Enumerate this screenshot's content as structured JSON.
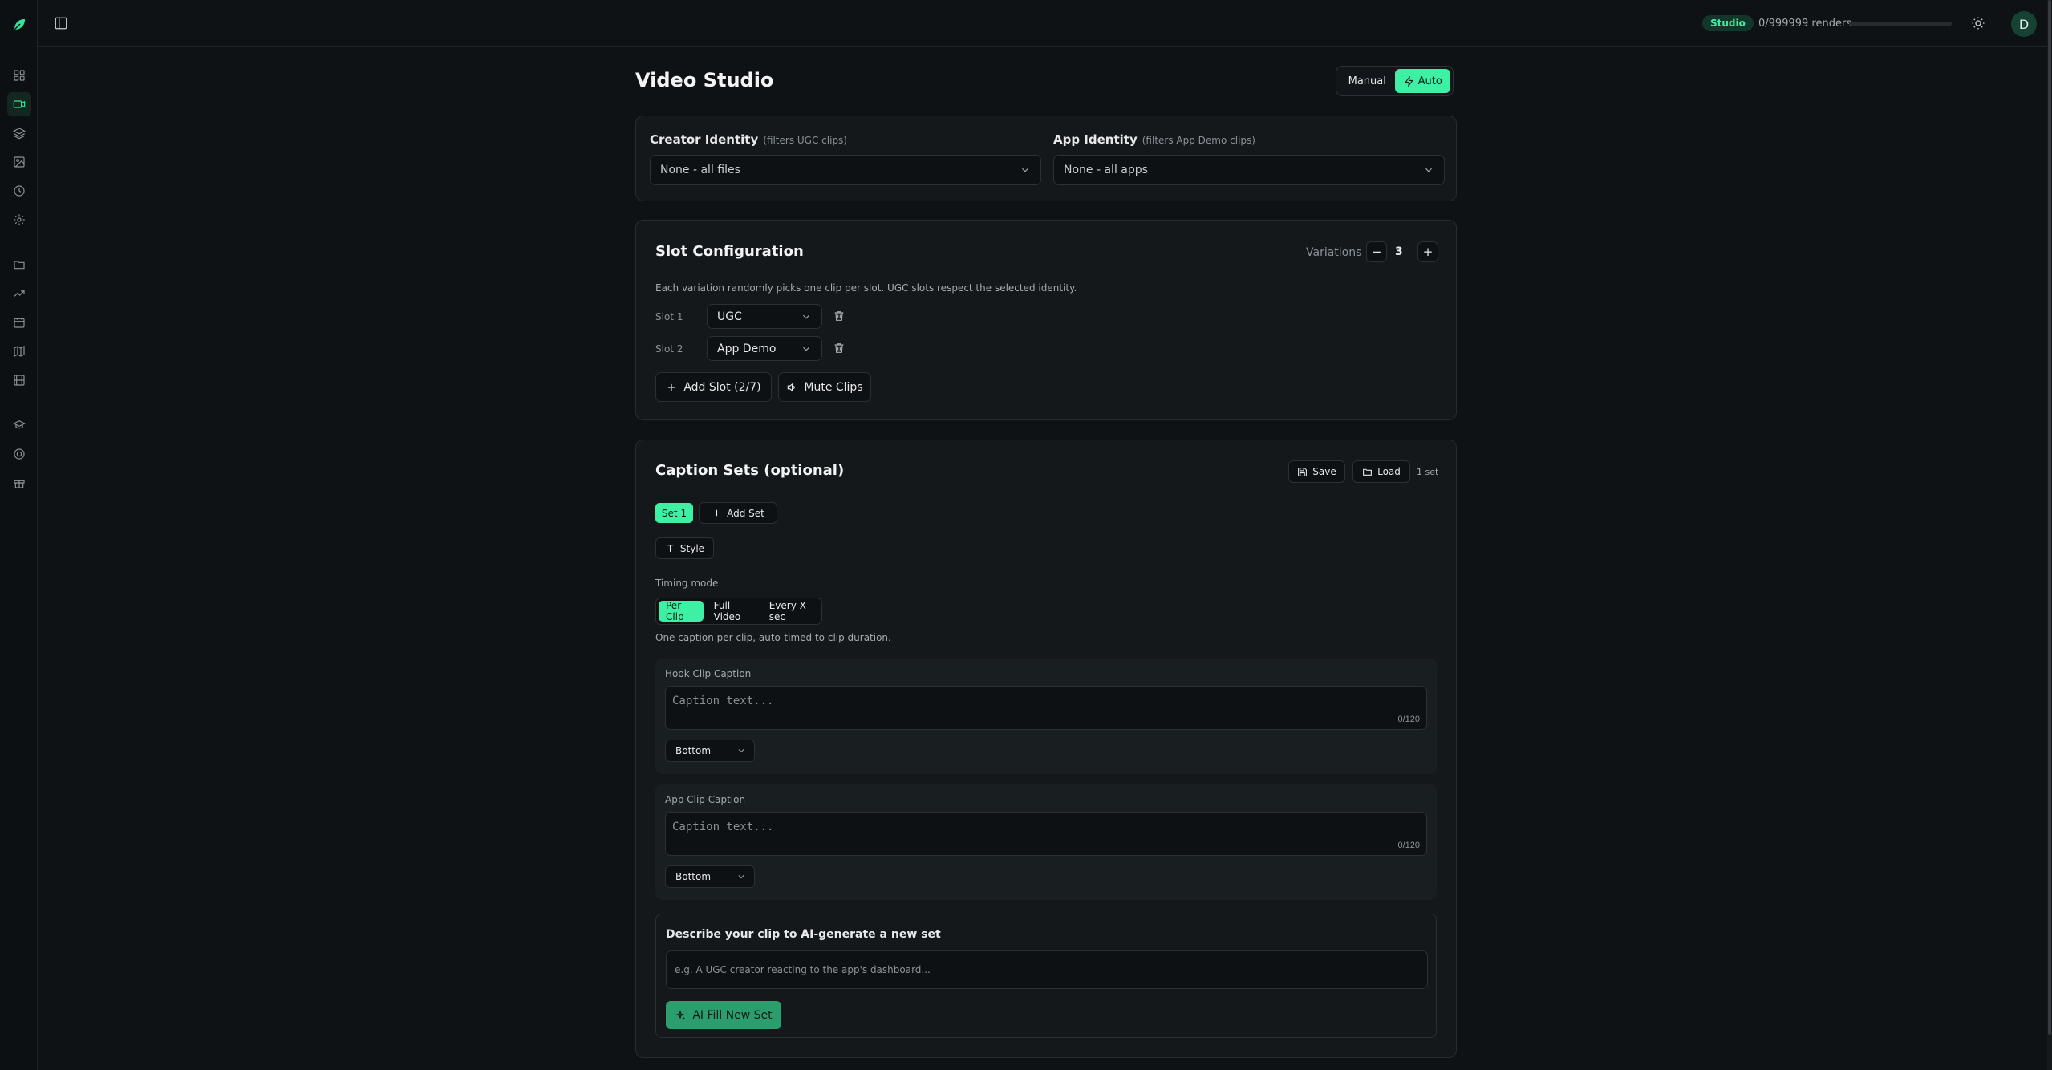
{
  "topbar": {
    "badge": "Studio",
    "renders": "0/999999 renders",
    "render_progress_percent": 0,
    "avatar_initial": "D"
  },
  "sidebar": {
    "icons": [
      "dashboard-icon",
      "video-icon",
      "layers-icon",
      "image-icon",
      "clock-icon",
      "settings-icon",
      "folder-icon",
      "trending-icon",
      "calendar-icon",
      "map-icon",
      "film-icon",
      "graduation-icon",
      "help-circle-icon",
      "gift-icon"
    ],
    "active": "video-icon"
  },
  "page": {
    "title": "Video Studio",
    "mode_manual": "Manual",
    "mode_auto": "Auto",
    "active_mode": "Auto"
  },
  "identity": {
    "creator_label": "Creator Identity",
    "creator_hint": "(filters UGC clips)",
    "creator_value": "None - all files",
    "app_label": "App Identity",
    "app_hint": "(filters App Demo clips)",
    "app_value": "None - all apps"
  },
  "slots": {
    "title": "Slot Configuration",
    "variations_label": "Variations",
    "variations_value": "3",
    "minus": "−",
    "plus": "+",
    "description": "Each variation randomly picks one clip per slot. UGC slots respect the selected identity.",
    "items": [
      {
        "label": "Slot 1",
        "value": "UGC"
      },
      {
        "label": "Slot 2",
        "value": "App Demo"
      }
    ],
    "add_slot": "Add Slot (2/7)",
    "mute_clips": "Mute Clips"
  },
  "captions": {
    "title": "Caption Sets (optional)",
    "save": "Save",
    "load": "Load",
    "set_count": "1 set",
    "active_set": "Set 1",
    "add_set": "Add Set",
    "style": "Style",
    "timing_label": "Timing mode",
    "timing_modes": [
      "Per Clip",
      "Full Video",
      "Every X sec"
    ],
    "active_timing": "Per Clip",
    "timing_description": "One caption per clip, auto-timed to clip duration.",
    "clips": [
      {
        "label": "Hook Clip Caption",
        "placeholder": "Caption text...",
        "counter": "0/120",
        "position": "Bottom"
      },
      {
        "label": "App Clip Caption",
        "placeholder": "Caption text...",
        "counter": "0/120",
        "position": "Bottom"
      }
    ],
    "ai_title": "Describe your clip to AI-generate a new set",
    "ai_placeholder": "e.g. A UGC creator reacting to the app's dashboard...",
    "ai_button": "AI Fill New Set"
  },
  "colors": {
    "accent": "#3ef0a4",
    "background": "#0f1214",
    "card": "#14181b"
  }
}
